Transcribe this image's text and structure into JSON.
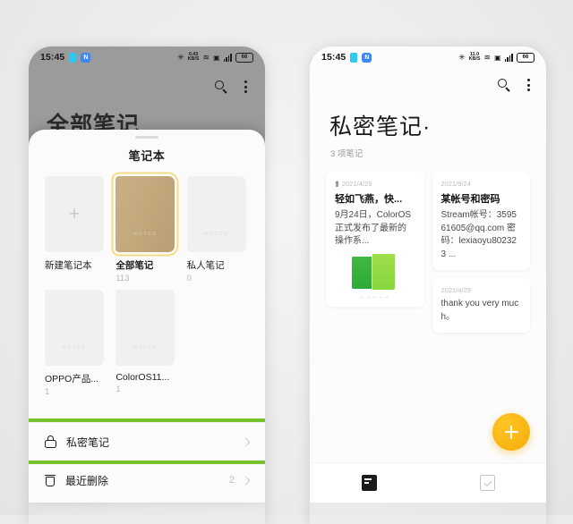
{
  "status_bar": {
    "time": "15:45",
    "data_rate_value": "0.43",
    "data_rate_unit": "KB/S",
    "data_rate_value_right": "11.0",
    "data_rate_unit_right": "KB/S",
    "battery": "66",
    "app_badge": "N"
  },
  "left_phone": {
    "background_title": "全部笔记",
    "sheet": {
      "title": "笔记本",
      "notebooks": [
        {
          "label": "新建笔记本",
          "count": "",
          "type": "add",
          "watermark": ""
        },
        {
          "label": "全部笔记",
          "count": "113",
          "type": "gold",
          "watermark": "NOTES",
          "selected": true
        },
        {
          "label": "私人笔记",
          "count": "0",
          "type": "plain",
          "watermark": "NOTES"
        },
        {
          "label": "OPPO产品...",
          "count": "1",
          "type": "plain",
          "watermark": "NOTES"
        },
        {
          "label": "ColorOS11...",
          "count": "1",
          "type": "plain",
          "watermark": "NOTES"
        }
      ],
      "rows": [
        {
          "label": "私密笔记",
          "count": "",
          "icon": "lock-icon",
          "highlighted": true
        },
        {
          "label": "最近删除",
          "count": "2",
          "icon": "trash-icon",
          "highlighted": false
        }
      ]
    }
  },
  "right_phone": {
    "title": "私密笔记·",
    "subtitle": "3 项笔记",
    "notes": [
      {
        "date": "2021/4/29",
        "pinned": true,
        "headline": "轻如飞燕，快...",
        "body": "9月24日，ColorOS正式发布了最新的操作系...",
        "has_image": true
      },
      {
        "date": "2021/9/24",
        "pinned": false,
        "headline": "某帐号和密码",
        "body": "Stream帐号：359561605@qq.com 密码：lexiaoyu802323 ...",
        "has_image": false
      },
      {
        "date": "2021/4/29",
        "pinned": false,
        "headline": "",
        "body": "thank you very much。",
        "has_image": false
      }
    ],
    "fab_label": "add-note",
    "nav": [
      {
        "name": "notes-tab",
        "active": true
      },
      {
        "name": "todo-tab",
        "active": false
      }
    ]
  },
  "colors": {
    "accent_yellow": "#f5ab07",
    "highlight_green": "#78c22c",
    "notebook_gold": "#c2a77b"
  }
}
